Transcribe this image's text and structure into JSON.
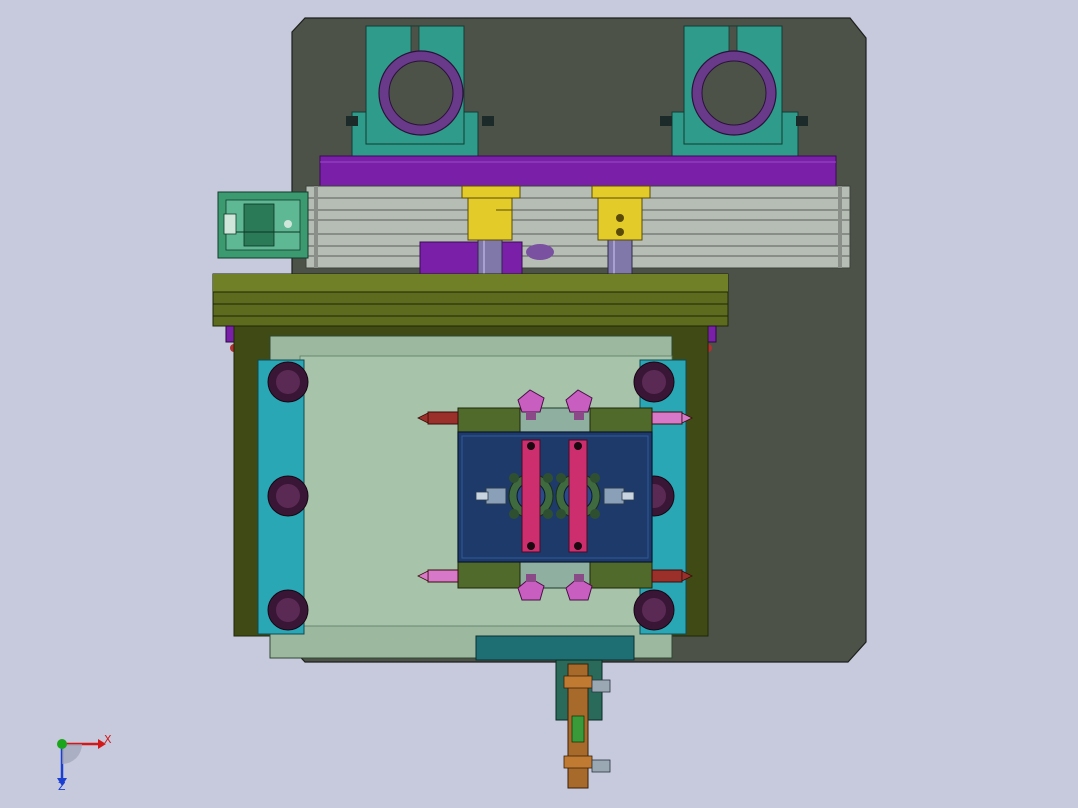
{
  "viewport": {
    "background": "#c7c9dc"
  },
  "model": {
    "colors": {
      "base_plate": "#4d5249",
      "bearing_block": "#2f9b8a",
      "bearing_ring": "#6a3a8a",
      "purple_beam": "#7a1fa8",
      "rail": "#b5bdb4",
      "olive_plate": "#5c6b1e",
      "olive_dark": "#3f4a14",
      "mold_plate": "#9cb9a0",
      "cyan_bar": "#2aa7b5",
      "clamp_disc": "#3a1636",
      "guide_rod": "#7f78a8",
      "yellow_collar": "#e3cc2a",
      "cavity_block": "#1d3a6b",
      "magenta_link": "#cc2e6e",
      "pink_nozzle": "#c85fc0",
      "red_fitting": "#9b2f2a",
      "teal_bottom": "#1e6f73",
      "copper_sprue": "#a86a2a",
      "green_motor": "#3c9a70"
    }
  },
  "triad": {
    "x_label": "X",
    "z_label": "Z",
    "x_color": "#d11919",
    "z_color": "#1a3fd1",
    "y_color": "#1aa51a"
  }
}
